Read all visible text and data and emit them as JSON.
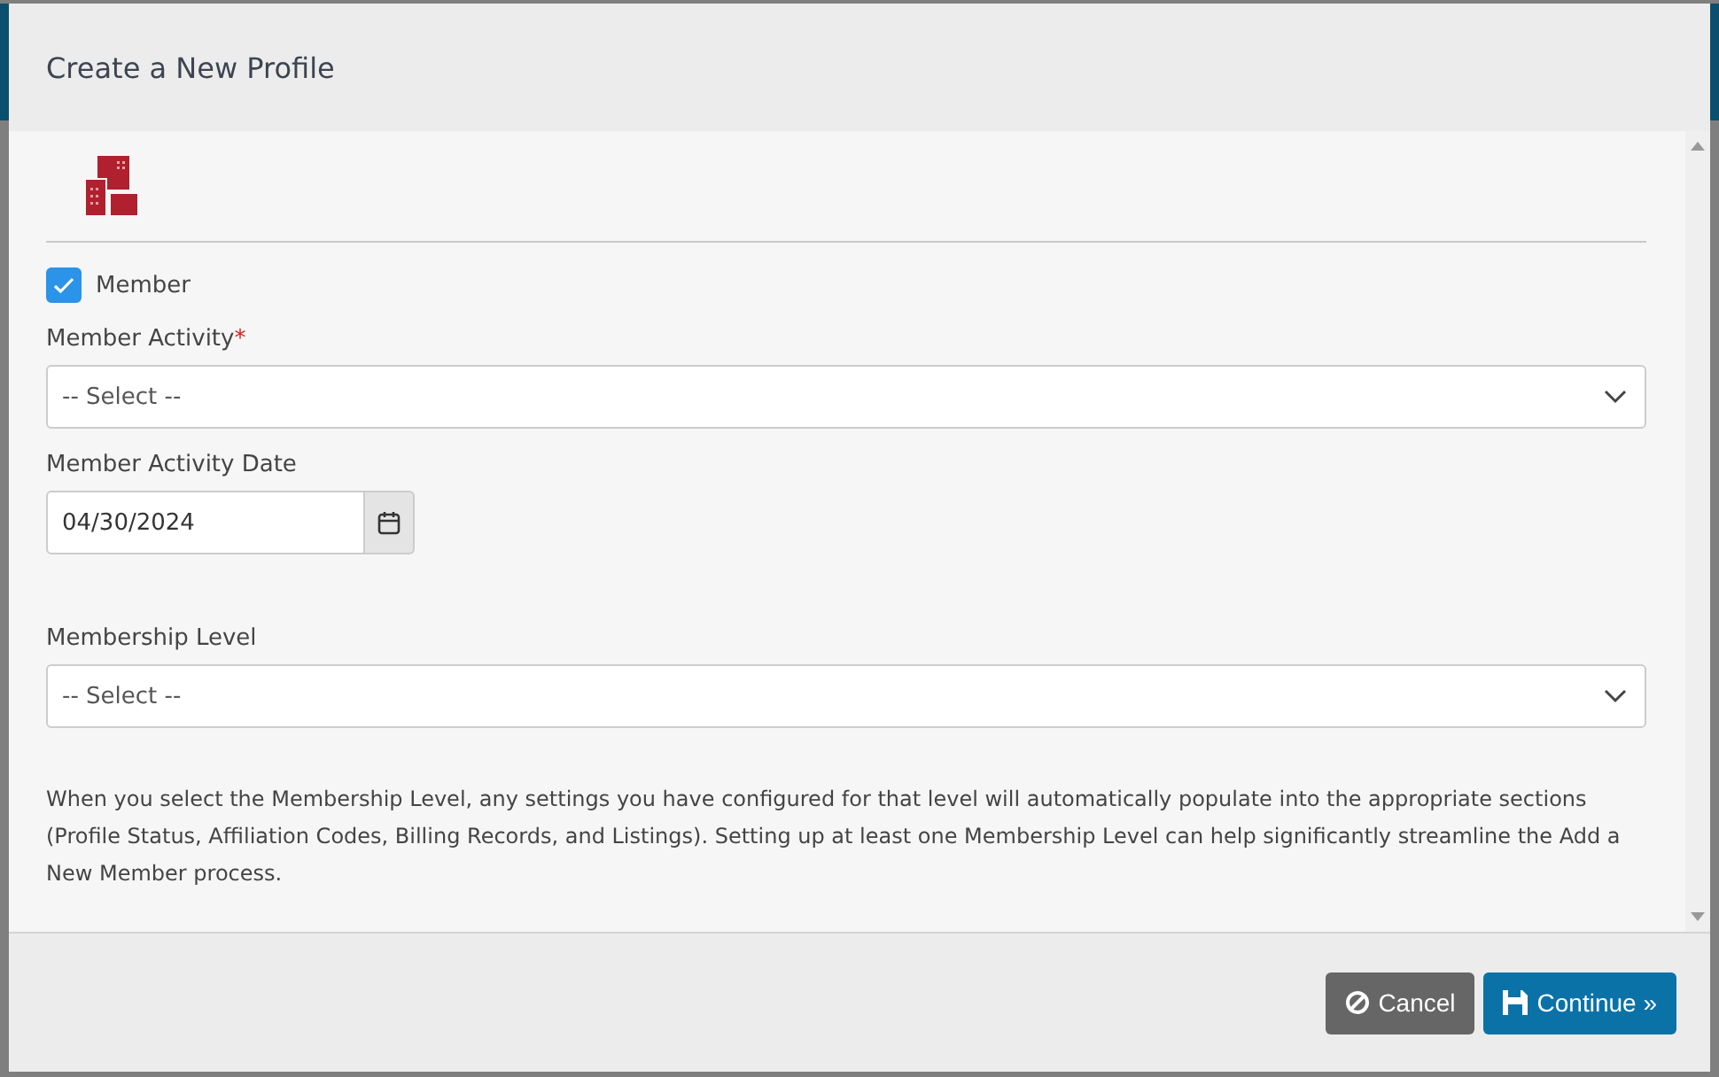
{
  "dialog": {
    "title": "Create a New Profile"
  },
  "member": {
    "label": "Member",
    "checked": true
  },
  "fields": [
    {
      "kind": "select",
      "label": "Member Activity",
      "required_mark": "*",
      "placeholder": "-- Select --"
    },
    {
      "kind": "date",
      "label": "Member Activity Date",
      "value": "04/30/2024"
    },
    {
      "kind": "select",
      "label": "Membership Level",
      "placeholder": "-- Select --"
    }
  ],
  "help_text": "When you select the Membership Level, any settings you have configured for that level will automatically populate into the appropriate sections (Profile Status, Affiliation Codes, Billing Records, and Listings). Setting up at least one Membership Level can help significantly streamline the Add a New Member process.",
  "buttons": [
    {
      "kind": "cancel",
      "label": "Cancel"
    },
    {
      "kind": "continue",
      "label": "Continue »"
    }
  ]
}
